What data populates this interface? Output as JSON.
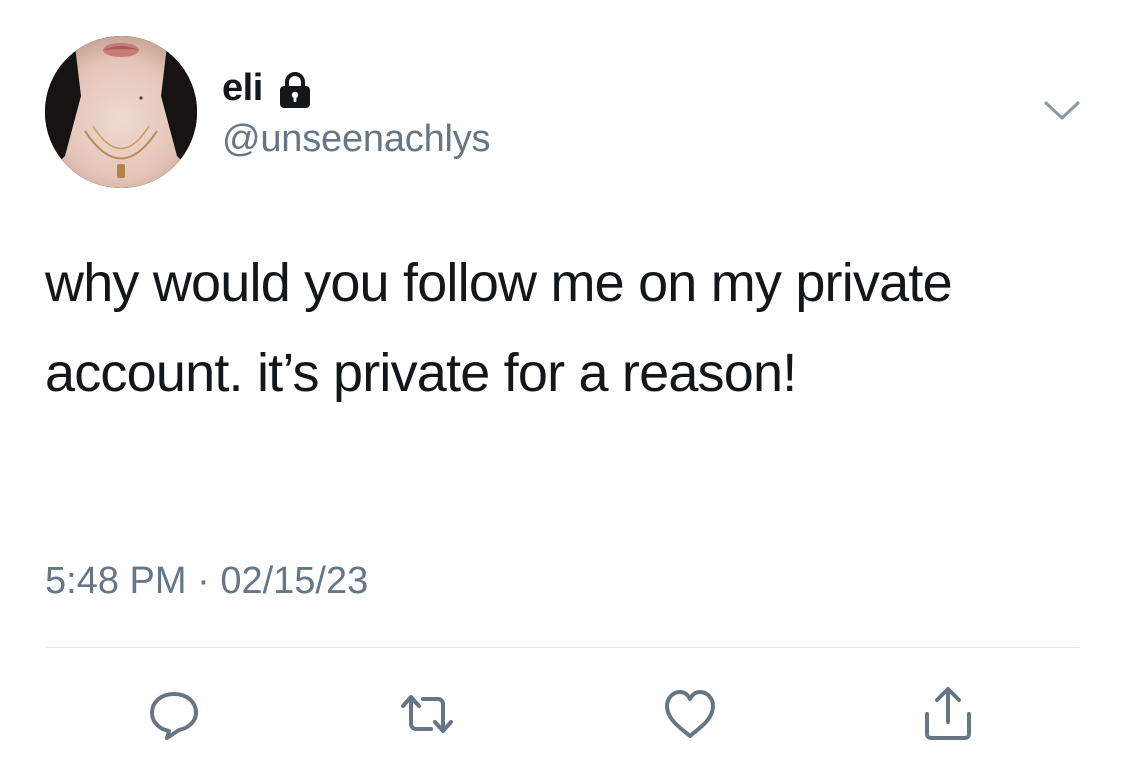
{
  "tweet": {
    "display_name": "eli",
    "handle": "@unseenachlys",
    "text": "why would you follow me on my private account. it’s private for a reason!",
    "time": "5:48 PM",
    "separator": " · ",
    "date": "02/15/23"
  },
  "icons": {
    "lock": "lock-icon",
    "caret": "chevron-down-icon",
    "reply": "reply-icon",
    "retweet": "retweet-icon",
    "like": "heart-icon",
    "share": "share-icon"
  },
  "colors": {
    "primary_text": "#14171a",
    "secondary_text": "#657786",
    "divider": "#e1e8ed",
    "icon": "#657786"
  }
}
